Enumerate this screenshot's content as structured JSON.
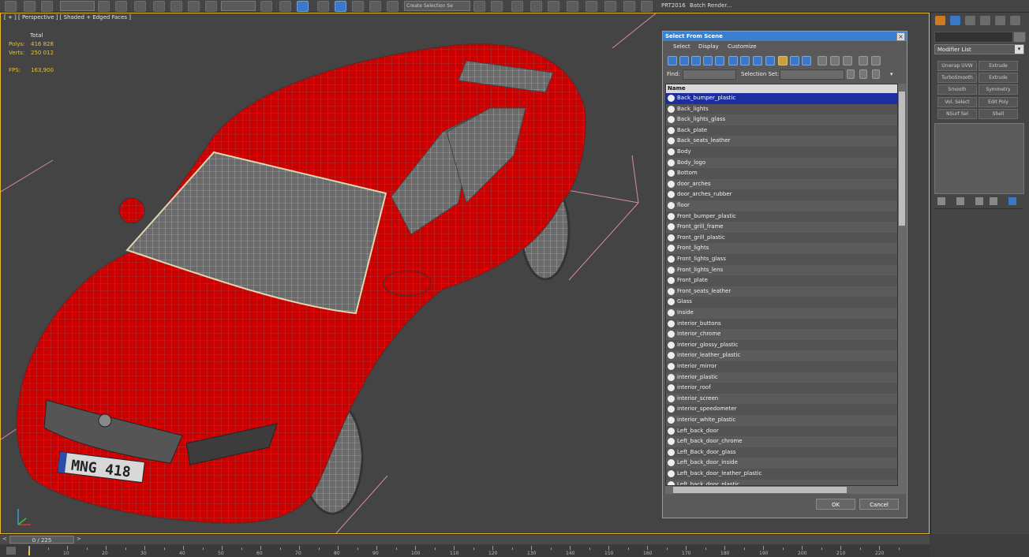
{
  "toolbar": {
    "named_selection_placeholder": "Create Selection Se",
    "prt_label": "PRT2016",
    "batch_render_label": "Batch Render..."
  },
  "viewport": {
    "label": "[ + ] [ Perspective ] [ Shaded + Edged Faces ]",
    "stats": {
      "total_label": "Total",
      "polys_label": "Polys:",
      "polys_value": "416 828",
      "verts_label": "Verts:",
      "verts_value": "250 012",
      "fps_label": "FPS:",
      "fps_value": "163,900"
    },
    "license_plate": "MNG 418"
  },
  "dialog": {
    "title": "Select From Scene",
    "close_glyph": "×",
    "menu": [
      "Select",
      "Display",
      "Customize"
    ],
    "find_label": "Find:",
    "find_value": "",
    "selection_set_label": "Selection Set:",
    "selection_set_value": "",
    "list_header": "Name",
    "items": [
      "Back_bumper_plastic",
      "Back_lights",
      "Back_lights_glass",
      "Back_plate",
      "Back_seats_leather",
      "Body",
      "Body_logo",
      "Bottom",
      "door_arches",
      "door_arches_rubber",
      "floor",
      "Front_bumper_plastic",
      "Front_grill_frame",
      "Front_grill_plastic",
      "Front_lights",
      "Front_lights_glass",
      "Front_lights_lens",
      "Front_plate",
      "Front_seats_leather",
      "Glass",
      "Inside",
      "interior_buttons",
      "Interior_chrome",
      "interior_glossy_plastic",
      "interior_leather_plastic",
      "interior_mirror",
      "interior_plastic",
      "interior_roof",
      "interior_screen",
      "interior_speedometer",
      "interior_white_plastic",
      "Left_back_door",
      "Left_back_door_chrome",
      "Left_Back_door_glass",
      "Left_back_door_inside",
      "Left_back_door_leather_plastic",
      "Left_back_door_plastic"
    ],
    "selected_index": 0,
    "ok_label": "OK",
    "cancel_label": "Cancel"
  },
  "command_panel": {
    "modifier_list_label": "Modifier List",
    "buttons": [
      [
        "Unwrap UVW",
        "Extrude"
      ],
      [
        "TurboSmooth",
        "Extrude"
      ],
      [
        "Smooth",
        "Symmetry"
      ],
      [
        "Vol. Select",
        "Edit Poly"
      ],
      [
        "NSurf Sel",
        "Shell"
      ]
    ]
  },
  "timeline": {
    "frame_readout": "0 / 225",
    "ticks": [
      "10",
      "20",
      "30",
      "40",
      "50",
      "60",
      "70",
      "80",
      "90",
      "100",
      "110",
      "120",
      "130",
      "140",
      "150",
      "160",
      "170",
      "180",
      "190",
      "200",
      "210",
      "220"
    ]
  },
  "colors": {
    "viewport_border": "#e8b830",
    "stats_color": "#e2c14a",
    "car_body": "#cc0000",
    "dialog_title_bg": "#3b7fd0",
    "selected_row_bg": "#1c2ea0"
  }
}
